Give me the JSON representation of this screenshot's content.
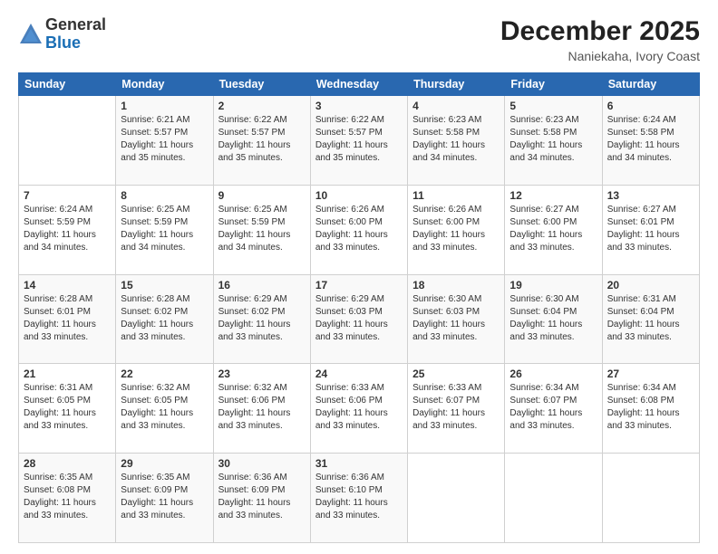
{
  "logo": {
    "general": "General",
    "blue": "Blue"
  },
  "title": {
    "month_year": "December 2025",
    "location": "Naniekaha, Ivory Coast"
  },
  "days": [
    "Sunday",
    "Monday",
    "Tuesday",
    "Wednesday",
    "Thursday",
    "Friday",
    "Saturday"
  ],
  "weeks": [
    [
      {
        "day": "",
        "sunrise": "",
        "sunset": "",
        "daylight": ""
      },
      {
        "day": "1",
        "sunrise": "Sunrise: 6:21 AM",
        "sunset": "Sunset: 5:57 PM",
        "daylight": "Daylight: 11 hours and 35 minutes."
      },
      {
        "day": "2",
        "sunrise": "Sunrise: 6:22 AM",
        "sunset": "Sunset: 5:57 PM",
        "daylight": "Daylight: 11 hours and 35 minutes."
      },
      {
        "day": "3",
        "sunrise": "Sunrise: 6:22 AM",
        "sunset": "Sunset: 5:57 PM",
        "daylight": "Daylight: 11 hours and 35 minutes."
      },
      {
        "day": "4",
        "sunrise": "Sunrise: 6:23 AM",
        "sunset": "Sunset: 5:58 PM",
        "daylight": "Daylight: 11 hours and 34 minutes."
      },
      {
        "day": "5",
        "sunrise": "Sunrise: 6:23 AM",
        "sunset": "Sunset: 5:58 PM",
        "daylight": "Daylight: 11 hours and 34 minutes."
      },
      {
        "day": "6",
        "sunrise": "Sunrise: 6:24 AM",
        "sunset": "Sunset: 5:58 PM",
        "daylight": "Daylight: 11 hours and 34 minutes."
      }
    ],
    [
      {
        "day": "7",
        "sunrise": "Sunrise: 6:24 AM",
        "sunset": "Sunset: 5:59 PM",
        "daylight": "Daylight: 11 hours and 34 minutes."
      },
      {
        "day": "8",
        "sunrise": "Sunrise: 6:25 AM",
        "sunset": "Sunset: 5:59 PM",
        "daylight": "Daylight: 11 hours and 34 minutes."
      },
      {
        "day": "9",
        "sunrise": "Sunrise: 6:25 AM",
        "sunset": "Sunset: 5:59 PM",
        "daylight": "Daylight: 11 hours and 34 minutes."
      },
      {
        "day": "10",
        "sunrise": "Sunrise: 6:26 AM",
        "sunset": "Sunset: 6:00 PM",
        "daylight": "Daylight: 11 hours and 33 minutes."
      },
      {
        "day": "11",
        "sunrise": "Sunrise: 6:26 AM",
        "sunset": "Sunset: 6:00 PM",
        "daylight": "Daylight: 11 hours and 33 minutes."
      },
      {
        "day": "12",
        "sunrise": "Sunrise: 6:27 AM",
        "sunset": "Sunset: 6:00 PM",
        "daylight": "Daylight: 11 hours and 33 minutes."
      },
      {
        "day": "13",
        "sunrise": "Sunrise: 6:27 AM",
        "sunset": "Sunset: 6:01 PM",
        "daylight": "Daylight: 11 hours and 33 minutes."
      }
    ],
    [
      {
        "day": "14",
        "sunrise": "Sunrise: 6:28 AM",
        "sunset": "Sunset: 6:01 PM",
        "daylight": "Daylight: 11 hours and 33 minutes."
      },
      {
        "day": "15",
        "sunrise": "Sunrise: 6:28 AM",
        "sunset": "Sunset: 6:02 PM",
        "daylight": "Daylight: 11 hours and 33 minutes."
      },
      {
        "day": "16",
        "sunrise": "Sunrise: 6:29 AM",
        "sunset": "Sunset: 6:02 PM",
        "daylight": "Daylight: 11 hours and 33 minutes."
      },
      {
        "day": "17",
        "sunrise": "Sunrise: 6:29 AM",
        "sunset": "Sunset: 6:03 PM",
        "daylight": "Daylight: 11 hours and 33 minutes."
      },
      {
        "day": "18",
        "sunrise": "Sunrise: 6:30 AM",
        "sunset": "Sunset: 6:03 PM",
        "daylight": "Daylight: 11 hours and 33 minutes."
      },
      {
        "day": "19",
        "sunrise": "Sunrise: 6:30 AM",
        "sunset": "Sunset: 6:04 PM",
        "daylight": "Daylight: 11 hours and 33 minutes."
      },
      {
        "day": "20",
        "sunrise": "Sunrise: 6:31 AM",
        "sunset": "Sunset: 6:04 PM",
        "daylight": "Daylight: 11 hours and 33 minutes."
      }
    ],
    [
      {
        "day": "21",
        "sunrise": "Sunrise: 6:31 AM",
        "sunset": "Sunset: 6:05 PM",
        "daylight": "Daylight: 11 hours and 33 minutes."
      },
      {
        "day": "22",
        "sunrise": "Sunrise: 6:32 AM",
        "sunset": "Sunset: 6:05 PM",
        "daylight": "Daylight: 11 hours and 33 minutes."
      },
      {
        "day": "23",
        "sunrise": "Sunrise: 6:32 AM",
        "sunset": "Sunset: 6:06 PM",
        "daylight": "Daylight: 11 hours and 33 minutes."
      },
      {
        "day": "24",
        "sunrise": "Sunrise: 6:33 AM",
        "sunset": "Sunset: 6:06 PM",
        "daylight": "Daylight: 11 hours and 33 minutes."
      },
      {
        "day": "25",
        "sunrise": "Sunrise: 6:33 AM",
        "sunset": "Sunset: 6:07 PM",
        "daylight": "Daylight: 11 hours and 33 minutes."
      },
      {
        "day": "26",
        "sunrise": "Sunrise: 6:34 AM",
        "sunset": "Sunset: 6:07 PM",
        "daylight": "Daylight: 11 hours and 33 minutes."
      },
      {
        "day": "27",
        "sunrise": "Sunrise: 6:34 AM",
        "sunset": "Sunset: 6:08 PM",
        "daylight": "Daylight: 11 hours and 33 minutes."
      }
    ],
    [
      {
        "day": "28",
        "sunrise": "Sunrise: 6:35 AM",
        "sunset": "Sunset: 6:08 PM",
        "daylight": "Daylight: 11 hours and 33 minutes."
      },
      {
        "day": "29",
        "sunrise": "Sunrise: 6:35 AM",
        "sunset": "Sunset: 6:09 PM",
        "daylight": "Daylight: 11 hours and 33 minutes."
      },
      {
        "day": "30",
        "sunrise": "Sunrise: 6:36 AM",
        "sunset": "Sunset: 6:09 PM",
        "daylight": "Daylight: 11 hours and 33 minutes."
      },
      {
        "day": "31",
        "sunrise": "Sunrise: 6:36 AM",
        "sunset": "Sunset: 6:10 PM",
        "daylight": "Daylight: 11 hours and 33 minutes."
      },
      {
        "day": "",
        "sunrise": "",
        "sunset": "",
        "daylight": ""
      },
      {
        "day": "",
        "sunrise": "",
        "sunset": "",
        "daylight": ""
      },
      {
        "day": "",
        "sunrise": "",
        "sunset": "",
        "daylight": ""
      }
    ]
  ]
}
